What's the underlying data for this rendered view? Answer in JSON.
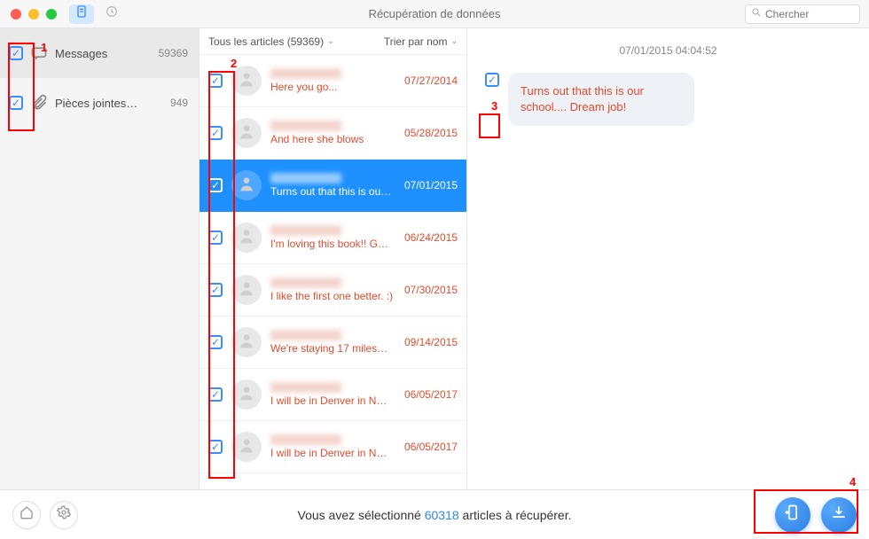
{
  "header": {
    "title": "Récupération de données",
    "search_placeholder": "Chercher"
  },
  "sidebar": {
    "items": [
      {
        "label": "Messages",
        "count": "59369"
      },
      {
        "label": "Pièces jointes…",
        "count": "949"
      }
    ]
  },
  "mid": {
    "filter_label": "Tous les articles (59369)",
    "sort_label": "Trier par nom",
    "rows": [
      {
        "preview": "Here you go...",
        "date": "07/27/2014"
      },
      {
        "preview": "And here she blows",
        "date": "05/28/2015"
      },
      {
        "preview": "Turns out that this is ou…",
        "date": "07/01/2015"
      },
      {
        "preview": "I'm loving this book!! G…",
        "date": "06/24/2015"
      },
      {
        "preview": "I like the first one better. :)",
        "date": "07/30/2015"
      },
      {
        "preview": "We're staying 17 miles…",
        "date": "09/14/2015"
      },
      {
        "preview": "I will be in Denver in N…",
        "date": "06/05/2017"
      },
      {
        "preview": "I will be in Denver in N…",
        "date": "06/05/2017"
      }
    ]
  },
  "preview": {
    "timestamp": "07/01/2015 04:04:52",
    "bubble_text": "Turns out that this is our school.... Dream job!"
  },
  "footer": {
    "prefix": "Vous avez sélectionné ",
    "count": "60318",
    "suffix": " articles à récupérer."
  },
  "annotations": {
    "a1": "1",
    "a2": "2",
    "a3": "3",
    "a4": "4"
  }
}
